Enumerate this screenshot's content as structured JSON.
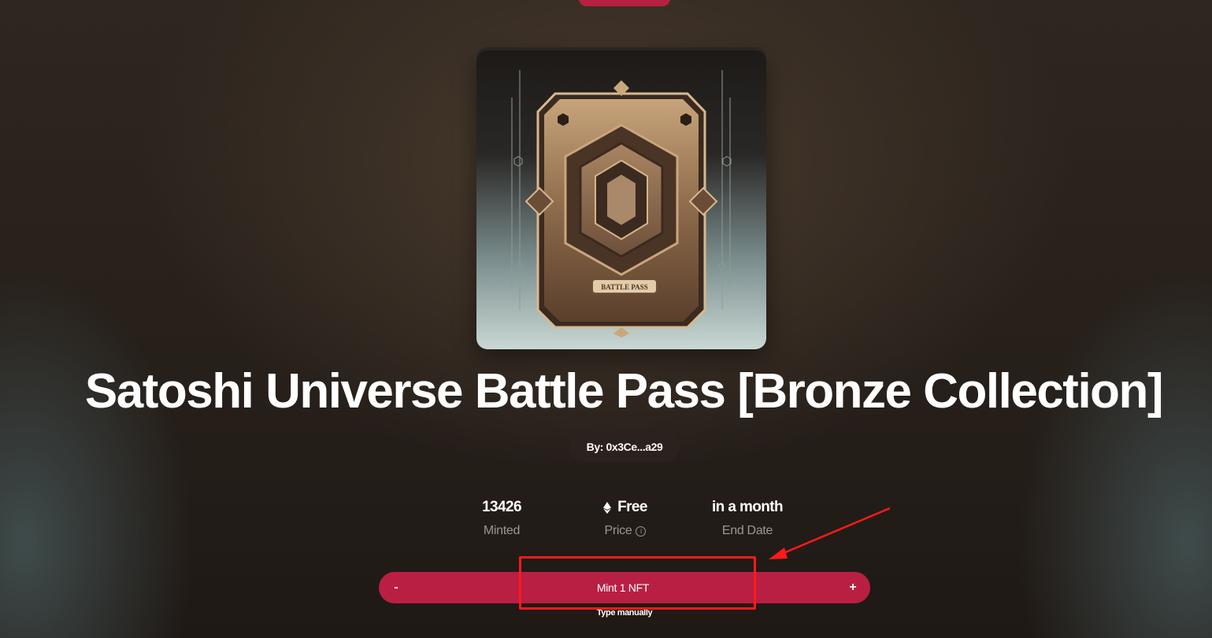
{
  "page": {
    "background": "#2b231d",
    "accent": "#b91f42"
  },
  "card": {
    "image_label": "BATTLE PASS"
  },
  "collection": {
    "title": "Satoshi Universe Battle Pass [Bronze Collection]",
    "creator": "By: 0x3Ce...a29"
  },
  "stats": [
    {
      "value": "13426",
      "label": "Minted"
    },
    {
      "value": "Free",
      "label": "Price",
      "icon": "ethereum-icon"
    },
    {
      "value": "in a month",
      "label": "End Date"
    }
  ],
  "mint": {
    "minus": "-",
    "label": "Mint 1 NFT",
    "plus": "+",
    "type_manually": "Type manually"
  },
  "annotation": {
    "color": "#ff1a1a"
  }
}
